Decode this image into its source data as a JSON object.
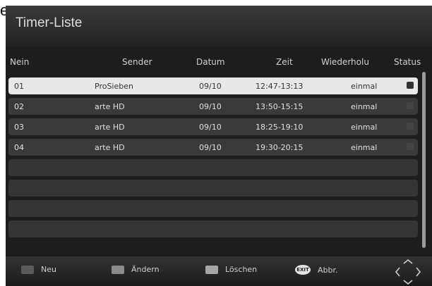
{
  "corner_text": "er",
  "title": "Timer-Liste",
  "columns": [
    "Nein",
    "Sender",
    "Datum",
    "Zeit",
    "Wiederholu",
    "Status"
  ],
  "rows": [
    {
      "nr": "01",
      "sender": "ProSieben",
      "date": "09/10",
      "time": "12:47-13:13",
      "repeat": "einmal",
      "selected": true
    },
    {
      "nr": "02",
      "sender": "arte HD",
      "date": "09/10",
      "time": "13:50-15:15",
      "repeat": "einmal",
      "selected": false
    },
    {
      "nr": "03",
      "sender": "arte HD",
      "date": "09/10",
      "time": "18:25-19:10",
      "repeat": "einmal",
      "selected": false
    },
    {
      "nr": "04",
      "sender": "arte HD",
      "date": "09/10",
      "time": "19:30-20:15",
      "repeat": "einmal",
      "selected": false
    }
  ],
  "footer": {
    "new_label": "Neu",
    "edit_label": "Ändern",
    "delete_label": "Löschen",
    "exit_key": "EXIT",
    "cancel_label": "Abbr."
  },
  "icons": {
    "navigation": "nav-arrows-icon",
    "exit": "exit-key-icon"
  }
}
